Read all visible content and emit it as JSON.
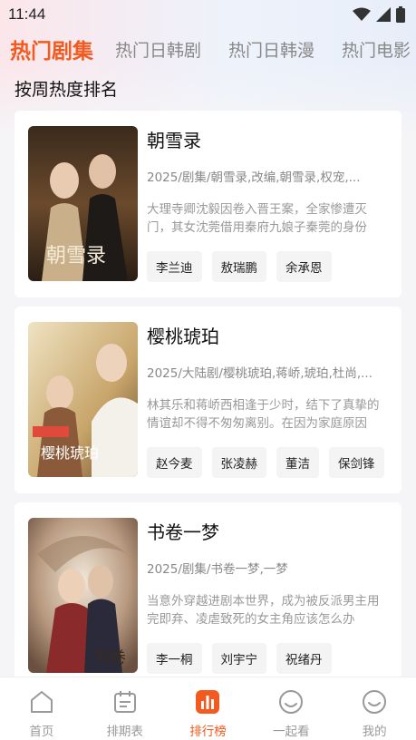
{
  "status_bar": {
    "time": "11:44"
  },
  "tabs": [
    {
      "label": "热门剧集",
      "active": true
    },
    {
      "label": "热门日韩剧",
      "active": false
    },
    {
      "label": "热门日韩漫",
      "active": false
    },
    {
      "label": "热门电影",
      "active": false
    }
  ],
  "subtitle": "按周热度排名",
  "shows": [
    {
      "title": "朝雪录",
      "meta": "2025/剧集/朝雪录,改编,朝雪录,权宠,...",
      "desc": "大理寺卿沈毅因卷入晋王案，全家惨遭灭门，其女沈莞借用秦府九娘子秦莞的身份",
      "cast": [
        "李兰迪",
        "敖瑞鹏",
        "余承恩"
      ],
      "poster_colors": [
        "#3a2a1c",
        "#6b4a2c",
        "#c8a878"
      ]
    },
    {
      "title": "樱桃琥珀",
      "meta": "2025/大陆剧/樱桃琥珀,蒋峤,琥珀,杜尚,...",
      "desc": "林其乐和蒋峤西相逢于少时，结下了真挚的情谊却不得不匆匆离别。在因为家庭原因",
      "cast": [
        "赵今麦",
        "张凌赫",
        "董洁",
        "保剑锋"
      ],
      "poster_colors": [
        "#e9d8b0",
        "#c8a56a",
        "#7a5a3a"
      ]
    },
    {
      "title": "书卷一梦",
      "meta": "2025/剧集/书卷一梦,一梦",
      "desc": "当意外穿越进剧本世界，成为被反派男主用完即弃、凌虐致死的女主角应该怎么办",
      "cast": [
        "李一桐",
        "刘宇宁",
        "祝绪丹"
      ],
      "poster_colors": [
        "#d9c7b2",
        "#a0806a",
        "#6a2a2a"
      ]
    }
  ],
  "bottom_nav": [
    {
      "label": "首页",
      "icon": "home-icon",
      "active": false
    },
    {
      "label": "排期表",
      "icon": "calendar-icon",
      "active": false
    },
    {
      "label": "排行榜",
      "icon": "ranking-icon",
      "active": true
    },
    {
      "label": "一起看",
      "icon": "smile-icon",
      "active": false
    },
    {
      "label": "我的",
      "icon": "profile-icon",
      "active": false
    }
  ],
  "colors": {
    "accent": "#f25a1f"
  }
}
